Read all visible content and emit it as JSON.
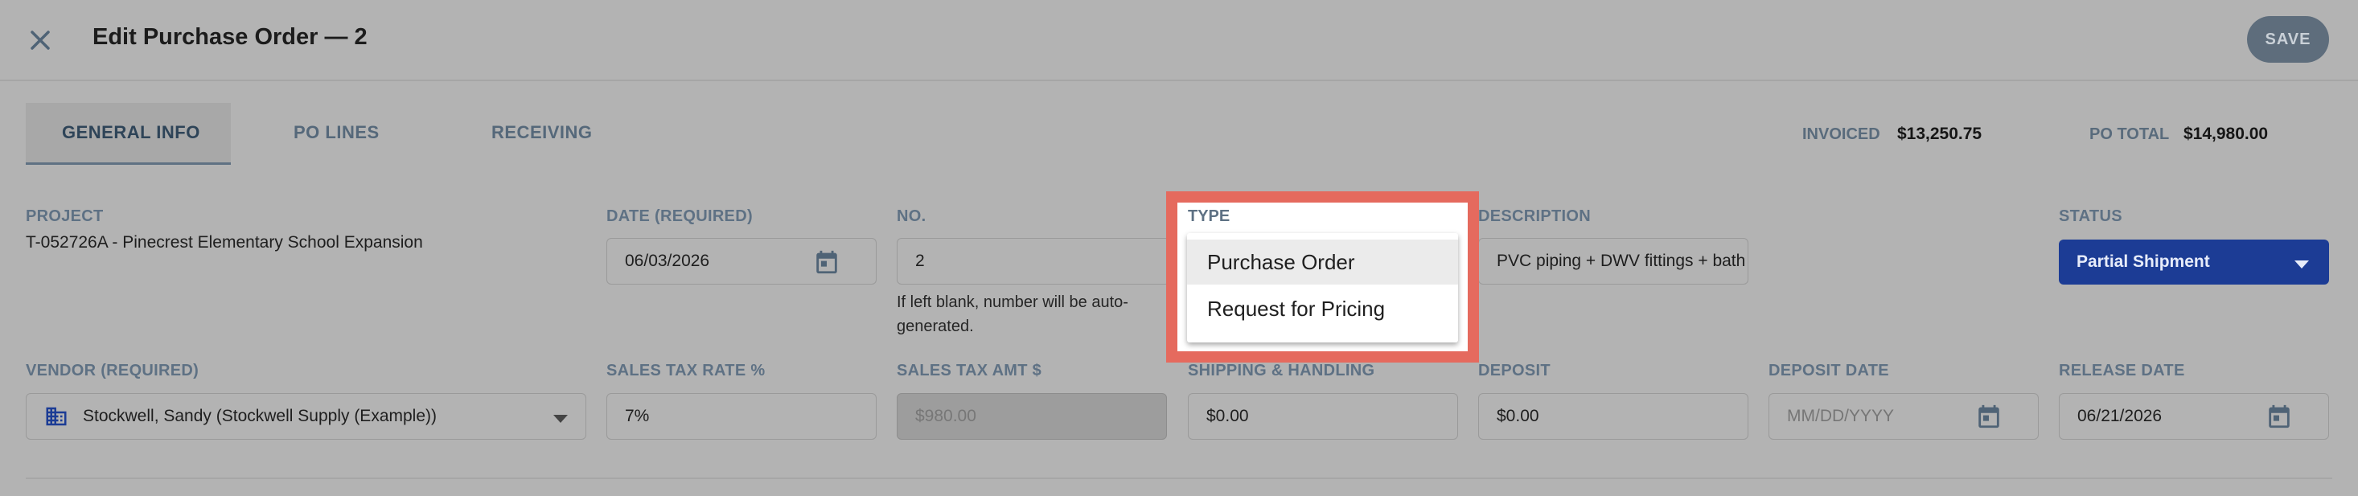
{
  "header": {
    "title": "Edit Purchase Order — 2",
    "save_label": "SAVE"
  },
  "tabs": [
    {
      "label": "GENERAL INFO",
      "active": true
    },
    {
      "label": "PO LINES",
      "active": false
    },
    {
      "label": "RECEIVING",
      "active": false
    }
  ],
  "summary": {
    "invoiced_label": "INVOICED",
    "invoiced_value": "$13,250.75",
    "po_total_label": "PO TOTAL",
    "po_total_value": "$14,980.00"
  },
  "fields": {
    "project": {
      "label": "PROJECT",
      "value": "T-052726A - Pinecrest Elementary School Expansion"
    },
    "date": {
      "label": "DATE (REQUIRED)",
      "value": "06/03/2026"
    },
    "number": {
      "label": "NO.",
      "value": "2",
      "helper": "If left blank, number will be auto-generated."
    },
    "type": {
      "label": "TYPE",
      "options": [
        "Purchase Order",
        "Request for Pricing"
      ],
      "selected": "Purchase Order"
    },
    "description": {
      "label": "DESCRIPTION",
      "value": "PVC piping + DWV fittings + bath fixture package"
    },
    "status": {
      "label": "STATUS",
      "value": "Partial Shipment"
    },
    "vendor": {
      "label": "VENDOR (REQUIRED)",
      "value": "Stockwell, Sandy (Stockwell Supply (Example))"
    },
    "sales_tax_rate": {
      "label": "SALES TAX RATE %",
      "value": "7%"
    },
    "sales_tax_amt": {
      "label": "SALES TAX AMT $",
      "value": "$980.00"
    },
    "shipping": {
      "label": "SHIPPING & HANDLING",
      "value": "$0.00"
    },
    "deposit": {
      "label": "DEPOSIT",
      "value": "$0.00"
    },
    "deposit_date": {
      "label": "DEPOSIT DATE",
      "placeholder": "MM/DD/YYYY"
    },
    "release_date": {
      "label": "RELEASE DATE",
      "value": "06/21/2026"
    }
  },
  "colors": {
    "status_bg": "#1c3c95",
    "highlight": "#e56a5e",
    "save_bg": "#5e6d7c"
  },
  "icons": [
    "close-icon",
    "calendar-icon",
    "building-icon",
    "caret-down-icon"
  ]
}
